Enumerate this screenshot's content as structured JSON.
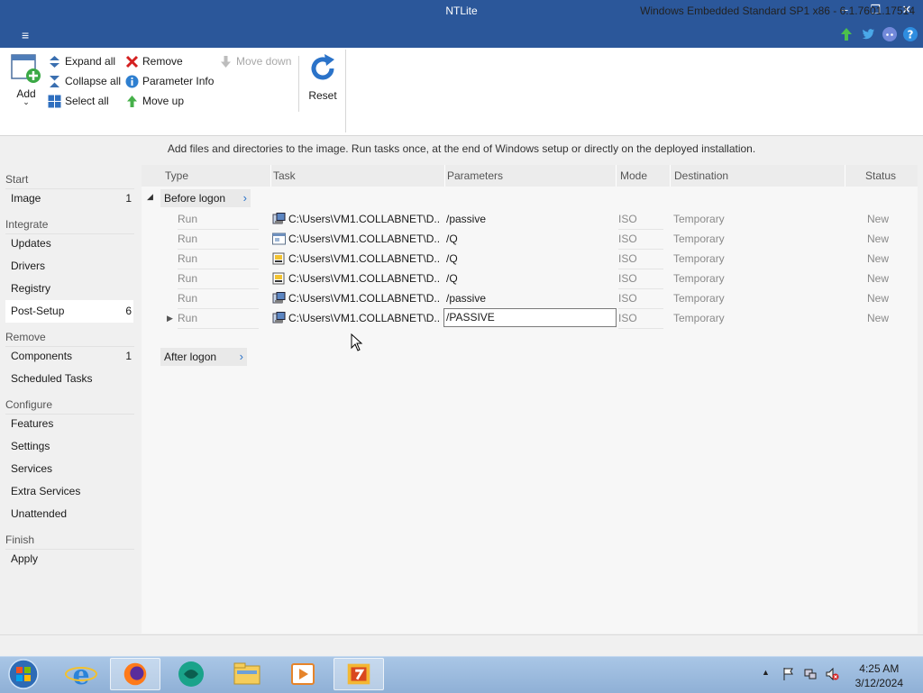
{
  "window": {
    "title": "NTLite",
    "minimize": "–",
    "restore": "❐",
    "close": "✕",
    "menu": "≡"
  },
  "top_icons": [
    "update-arrow-icon",
    "twitter-icon",
    "discord-icon",
    "help-icon"
  ],
  "ribbon": {
    "add": "Add",
    "expand_all": "Expand all",
    "collapse_all": "Collapse all",
    "select_all": "Select all",
    "remove": "Remove",
    "parameter_info": "Parameter Info",
    "move_up": "Move up",
    "move_down": "Move down",
    "reset": "Reset"
  },
  "info_text": "Add files and directories to the image. Run tasks once, at the end of Windows setup or directly on the deployed installation.",
  "sidebar": {
    "start": "Start",
    "image": "Image",
    "image_count": "1",
    "integrate": "Integrate",
    "updates": "Updates",
    "drivers": "Drivers",
    "registry": "Registry",
    "post_setup": "Post-Setup",
    "post_setup_count": "6",
    "remove": "Remove",
    "components": "Components",
    "components_count": "1",
    "scheduled_tasks": "Scheduled Tasks",
    "configure": "Configure",
    "features": "Features",
    "settings": "Settings",
    "services": "Services",
    "extra_services": "Extra Services",
    "unattended": "Unattended",
    "finish": "Finish",
    "apply": "Apply"
  },
  "table": {
    "columns": {
      "type": "Type",
      "task": "Task",
      "parameters": "Parameters",
      "mode": "Mode",
      "destination": "Destination",
      "status": "Status"
    },
    "group_before": "Before logon",
    "group_after": "After logon",
    "rows": [
      {
        "type": "Run",
        "task": "C:\\Users\\VM1.COLLABNET\\D...",
        "params": "/passive",
        "mode": "ISO",
        "dest": "Temporary",
        "status": "New"
      },
      {
        "type": "Run",
        "task": "C:\\Users\\VM1.COLLABNET\\D...",
        "params": "/Q",
        "mode": "ISO",
        "dest": "Temporary",
        "status": "New"
      },
      {
        "type": "Run",
        "task": "C:\\Users\\VM1.COLLABNET\\D...",
        "params": "/Q",
        "mode": "ISO",
        "dest": "Temporary",
        "status": "New"
      },
      {
        "type": "Run",
        "task": "C:\\Users\\VM1.COLLABNET\\D...",
        "params": "/Q",
        "mode": "ISO",
        "dest": "Temporary",
        "status": "New"
      },
      {
        "type": "Run",
        "task": "C:\\Users\\VM1.COLLABNET\\D...",
        "params": "/passive",
        "mode": "ISO",
        "dest": "Temporary",
        "status": "New"
      },
      {
        "type": "Run",
        "task": "C:\\Users\\VM1.COLLABNET\\D...",
        "params": "/PASSIVE",
        "mode": "ISO",
        "dest": "Temporary",
        "status": "New"
      }
    ]
  },
  "status_bar": "Windows Embedded Standard SP1 x86 - 6.1.7601.17514",
  "taskbar": {
    "apps": [
      "start-orb-icon",
      "internet-explorer-icon",
      "firefox-icon",
      "chat-app-icon",
      "file-explorer-icon",
      "media-player-icon",
      "ntlite-icon"
    ],
    "time": "4:25 AM",
    "date": "3/12/2024"
  },
  "colors": {
    "titlebar": "#2b579a",
    "accent": "#2b73c9",
    "remove": "#d42020",
    "add_green": "#3aa845"
  }
}
